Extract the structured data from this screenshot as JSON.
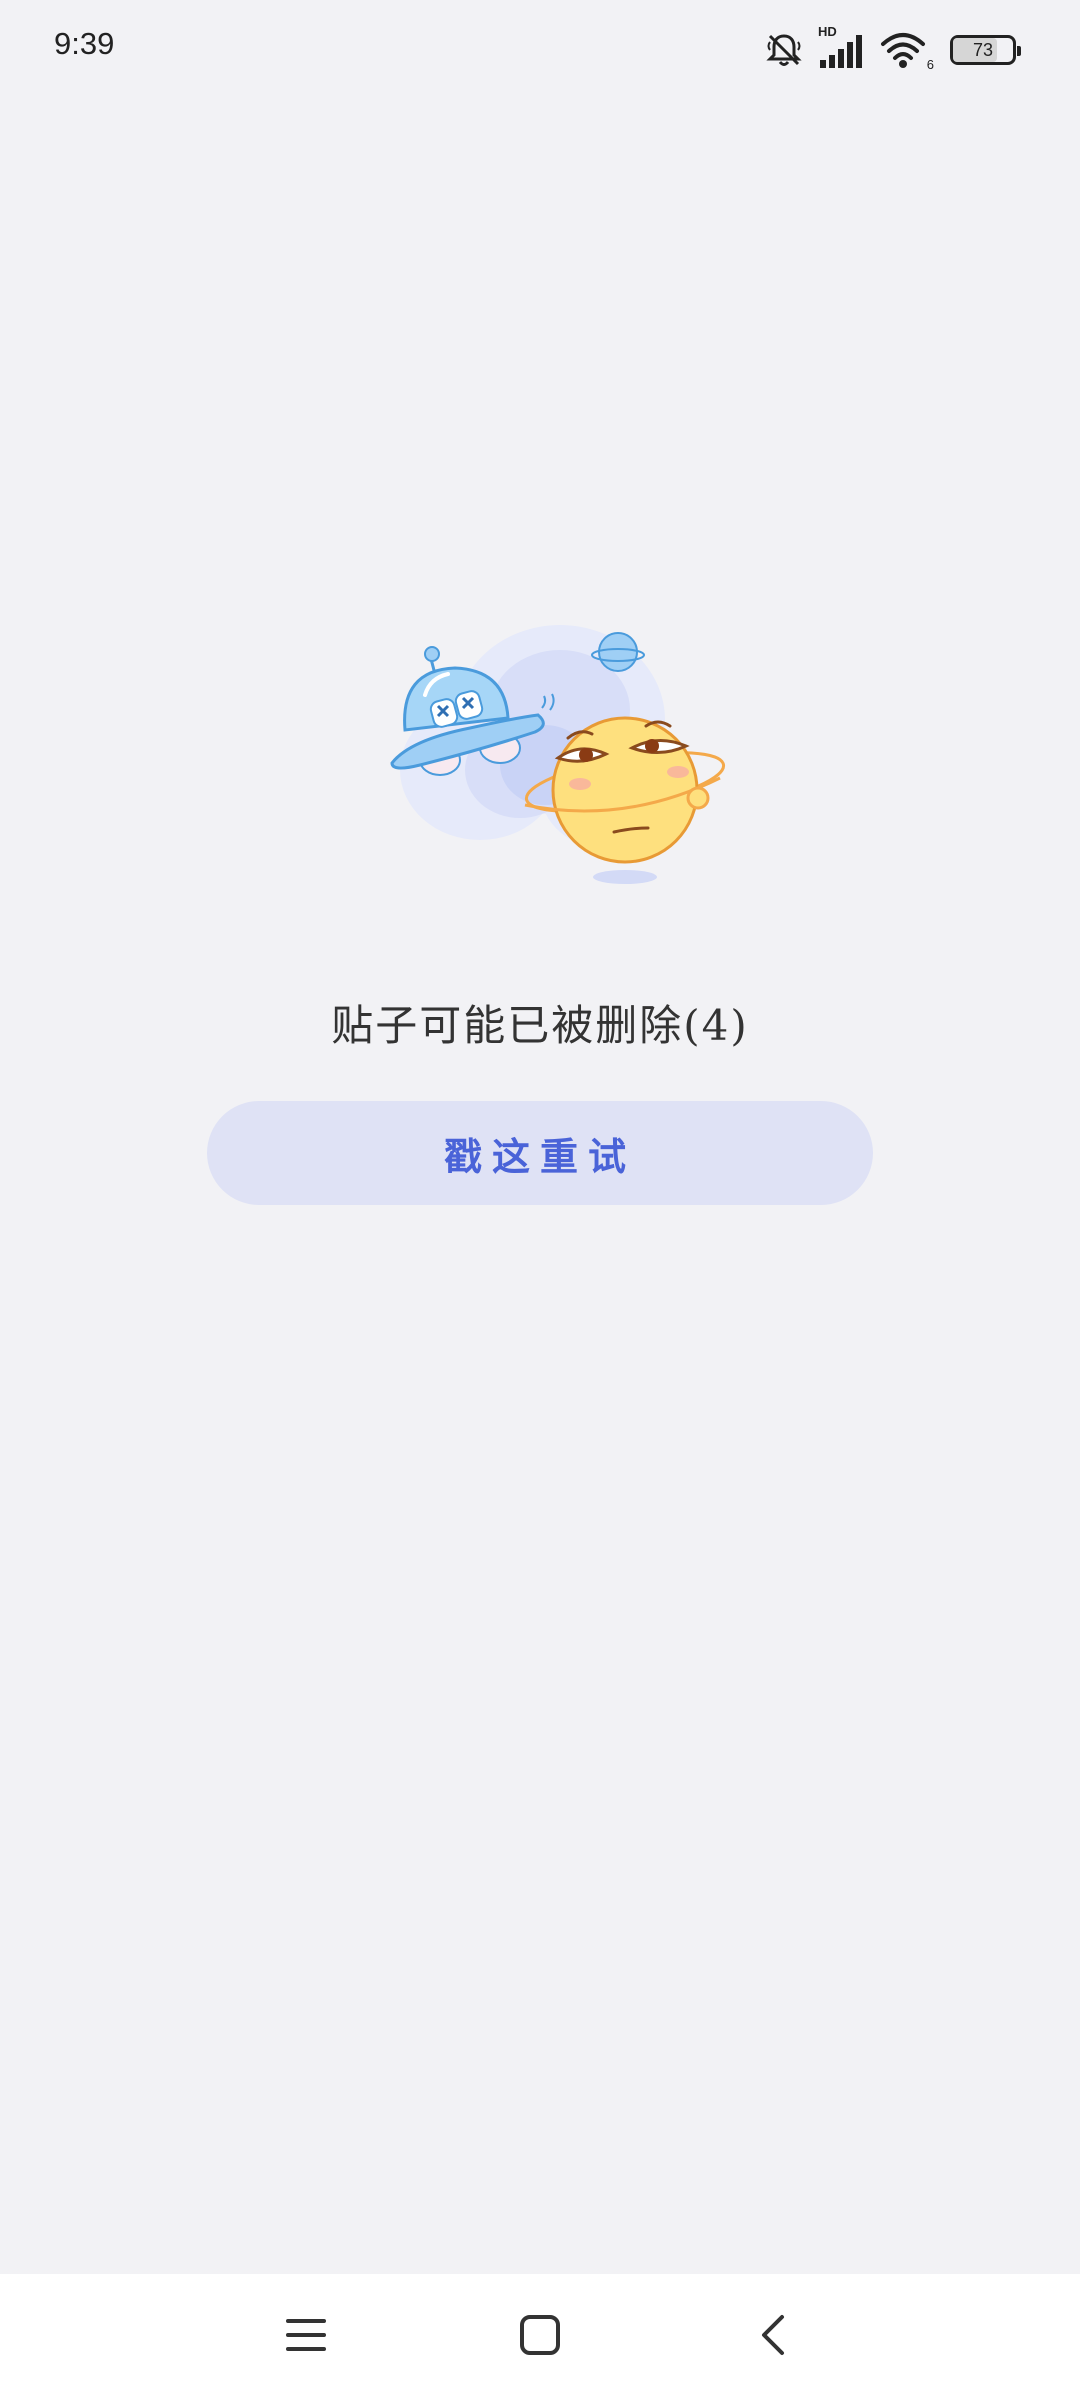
{
  "status_bar": {
    "time": "9:39",
    "network_badge": "HD",
    "wifi_badge": "6",
    "battery_percent": "73",
    "battery_level": 0.73,
    "icons": [
      "mute-icon",
      "cellular-signal-icon",
      "wifi-icon",
      "battery-icon"
    ]
  },
  "content": {
    "message": "贴子可能已被删除(4)",
    "retry_label": "戳这重试",
    "illustration": [
      "ufo-illustration",
      "planet-face-illustration"
    ]
  },
  "nav_bar": {
    "items": [
      "menu-icon",
      "home-icon",
      "back-icon"
    ]
  },
  "colors": {
    "background": "#f2f2f5",
    "button_background": "#dfe2f5",
    "button_text": "#4a63d8",
    "message_text": "#333333"
  }
}
